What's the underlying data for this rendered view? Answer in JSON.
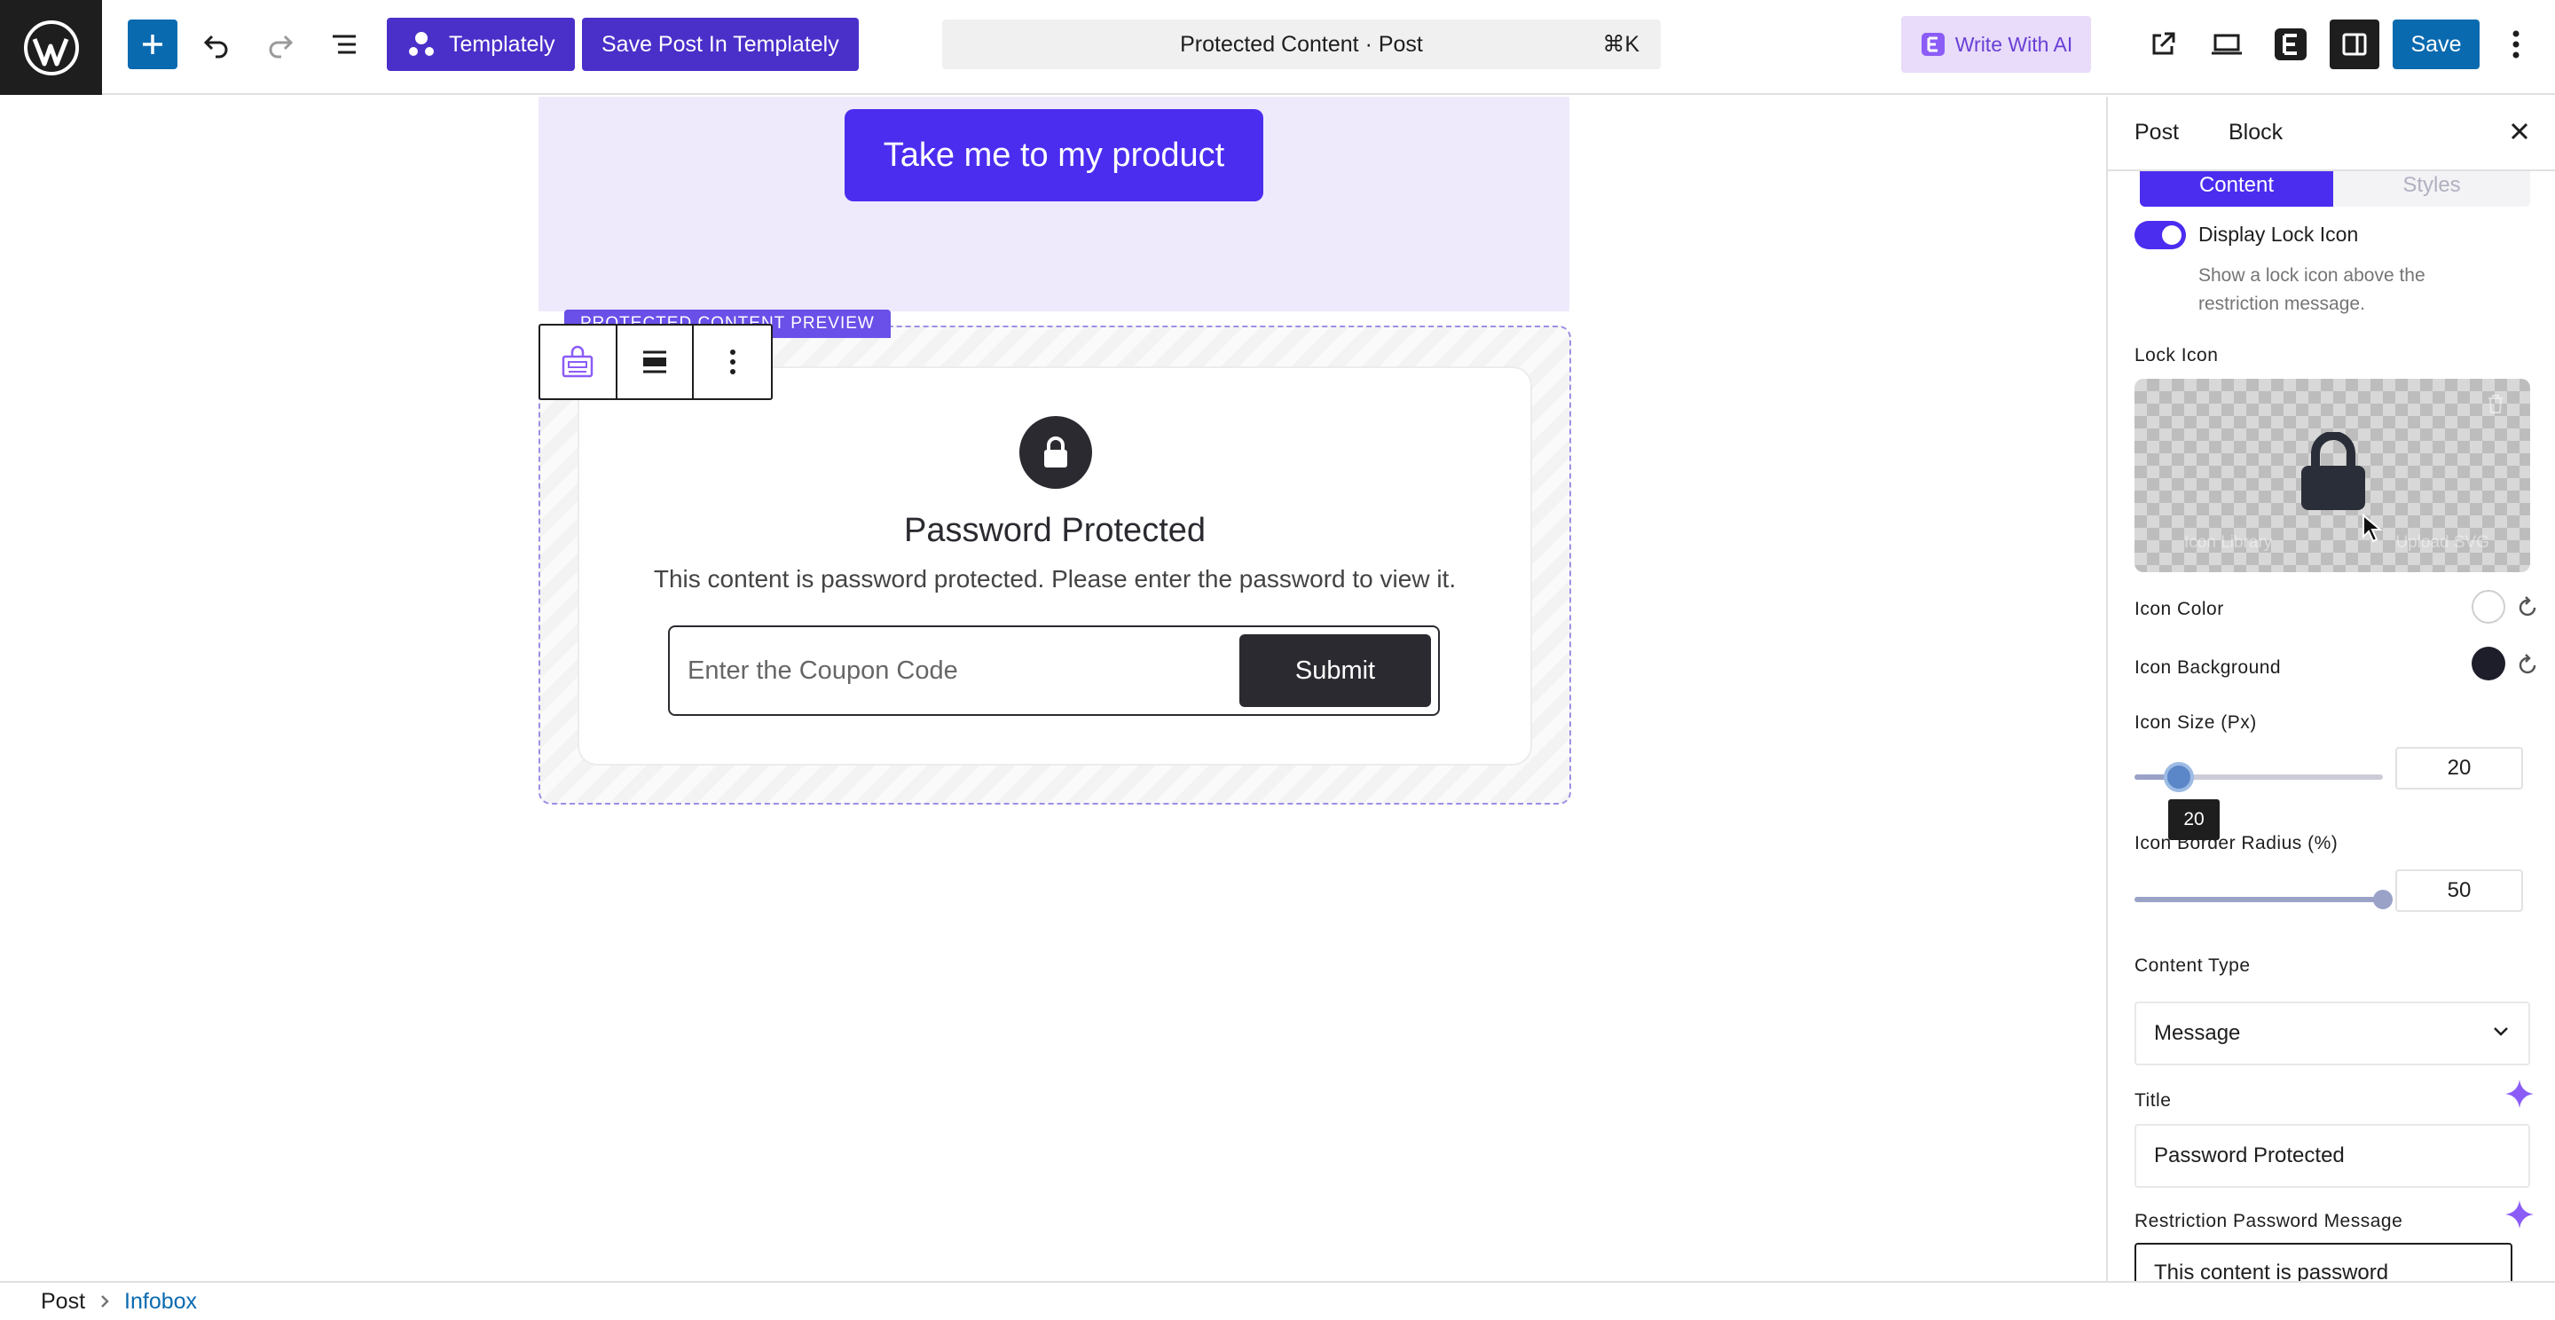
{
  "topbar": {
    "templately_label": "Templately",
    "save_in_templately_label": "Save Post In Templately",
    "command_title": "Protected Content · Post",
    "command_shortcut": "⌘K",
    "write_ai_label": "Write With AI",
    "save_label": "Save"
  },
  "canvas": {
    "hero_button": "Take me to my product",
    "preview_label": "PROTECTED CONTENT PREVIEW",
    "title": "Password Protected",
    "message": "This content is password protected. Please enter the password to view it.",
    "input_placeholder": "Enter the Coupon Code",
    "submit_label": "Submit"
  },
  "sidebar": {
    "tabs": [
      "Post",
      "Block"
    ],
    "active_tab": "Block",
    "segments": [
      "Content",
      "Styles"
    ],
    "active_segment": "Content",
    "display_lock_icon": {
      "label": "Display Lock Icon",
      "help": "Show a lock icon above the restriction message.",
      "enabled": true
    },
    "lock_icon_label": "Lock Icon",
    "icon_preview_ghost_left": "Icon Library",
    "icon_preview_ghost_right": "Upload SVG",
    "icon_color_label": "Icon Color",
    "icon_color": "#ffffff",
    "icon_background_label": "Icon Background",
    "icon_background": "#1e1e2a",
    "icon_size_label": "Icon Size (Px)",
    "icon_size_value": "20",
    "icon_size_fraction": 0.18,
    "icon_radius_label": "Icon Border Radius (%)",
    "icon_radius_value": "50",
    "icon_radius_fraction": 1.0,
    "content_type_label": "Content Type",
    "content_type_value": "Message",
    "title_label": "Title",
    "title_value": "Password Protected",
    "restriction_label": "Restriction Password Message",
    "restriction_value": "This content is password"
  },
  "footer": {
    "crumbs": [
      "Post",
      "Infobox"
    ]
  },
  "colors": {
    "accent": "#4b2df0",
    "wp_blue": "#0a6ab0",
    "templately_purple": "#4a2fc9",
    "hero_bg": "#efe9fc"
  }
}
